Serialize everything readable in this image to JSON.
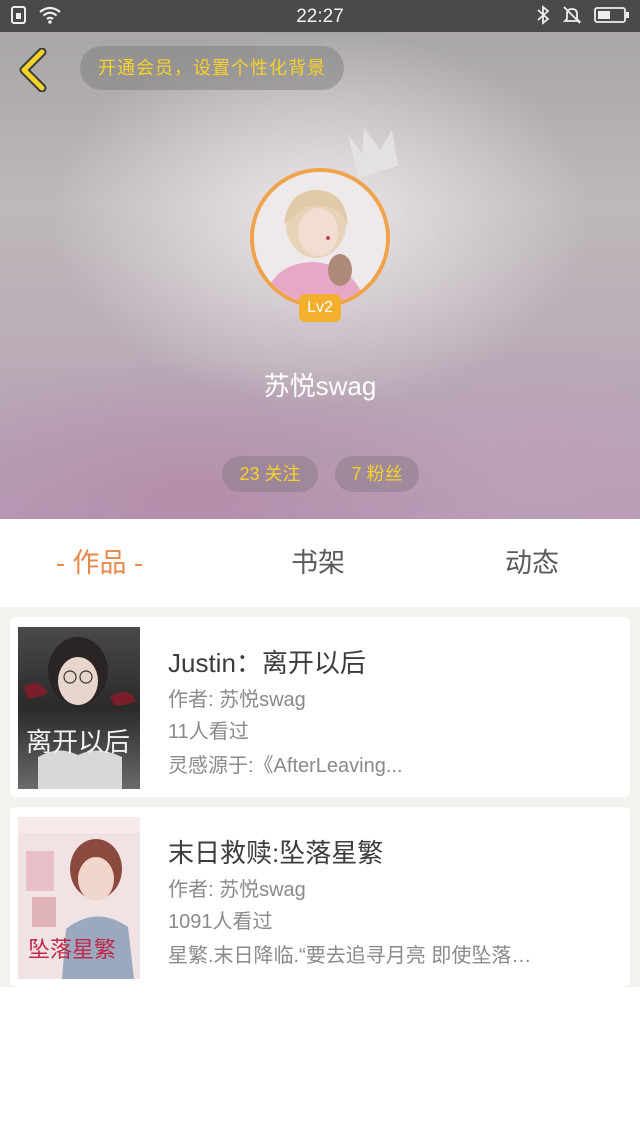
{
  "status_bar": {
    "time": "22:27",
    "left_icons": [
      "sim-icon",
      "wifi-icon"
    ],
    "right_icons": [
      "bluetooth-icon",
      "mute-icon",
      "battery-icon"
    ]
  },
  "header": {
    "vip_banner": "开通会员，设置个性化背景",
    "level": "Lv2",
    "username": "苏悦swag",
    "following": "23 关注",
    "fans": "7 粉丝"
  },
  "tabs": [
    {
      "label": "- 作品 -",
      "active": true
    },
    {
      "label": "书架",
      "active": false
    },
    {
      "label": "动态",
      "active": false
    }
  ],
  "works": [
    {
      "title": "Justin：离开以后",
      "author": "作者: 苏悦swag",
      "views": "11人看过",
      "description": "灵感源于:《AfterLeaving...",
      "cover_text": "离开以后"
    },
    {
      "title": "末日救赎:坠落星繁",
      "author": "作者: 苏悦swag",
      "views": "1091人看过",
      "description": "星繁.末日降临.“要去追寻月亮 即使坠落…",
      "cover_text": "坠落星繁"
    }
  ],
  "colors": {
    "accent": "#e8894a",
    "gold": "#f6d22a",
    "avatar_ring": "#f0a34a",
    "level_badge": "#f2b02e"
  }
}
